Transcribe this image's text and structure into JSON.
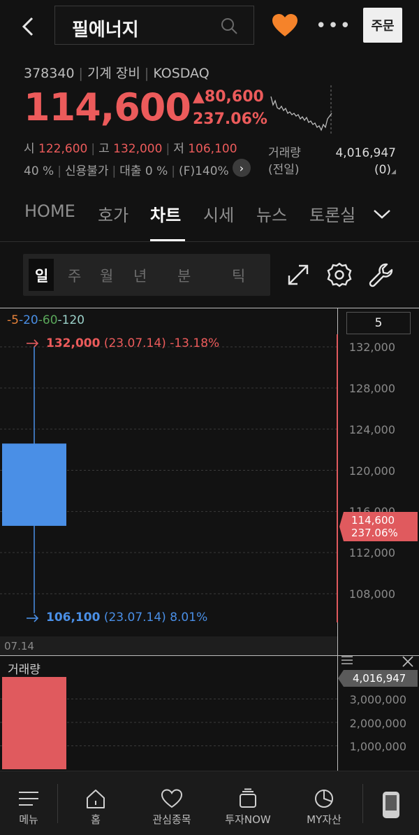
{
  "header": {
    "stock_name": "필에너지",
    "order_label": "주문",
    "more_label": "•••"
  },
  "stock": {
    "code": "378340",
    "sector": "기계 장비",
    "market": "KOSDAQ",
    "price": "114,600",
    "change": "▲80,600",
    "change_pct": "237.06%",
    "open_label": "시",
    "open": "122,600",
    "high_label": "고",
    "high": "132,000",
    "low_label": "저",
    "low": "106,100",
    "flags": [
      "40 %",
      "신용불가",
      "대출 0 %",
      "(F)140%"
    ],
    "prev_volume_label_1": "거래량",
    "prev_volume_label_2": "(전일)",
    "prev_volume_value": "4,016,947",
    "prev_volume_sub": "(0)"
  },
  "tabs": [
    "HOME",
    "호가",
    "차트",
    "시세",
    "뉴스",
    "토론실"
  ],
  "active_tab": "차트",
  "periods": [
    "일",
    "주",
    "월",
    "년",
    "분",
    "틱"
  ],
  "active_period": "일",
  "chart": {
    "ma_legend": [
      {
        "label": "5",
        "color": "#e6823a"
      },
      {
        "label": "20",
        "color": "#4a8fe6"
      },
      {
        "label": "60",
        "color": "#5aa85a"
      },
      {
        "label": "120",
        "color": "#9ad0c8"
      }
    ],
    "count_box": "5",
    "high_text": "132,000",
    "high_detail": "(23.07.14) -13.18%",
    "low_text": "106,100",
    "low_detail": "(23.07.14) 8.01%",
    "current_price": "114,600",
    "current_pct": "237.06%",
    "date_label": "07.14",
    "y_ticks": [
      "132,000",
      "128,000",
      "124,000",
      "120,000",
      "116,000",
      "112,000",
      "108,000"
    ],
    "volume_title": "거래량",
    "volume_value": "4,016,947",
    "volume_ticks": [
      "3,000,000",
      "2,000,000",
      "1,000,000"
    ]
  },
  "chart_data": {
    "type": "candlestick",
    "categories": [
      "07.14"
    ],
    "open": [
      122600
    ],
    "high": [
      132000
    ],
    "low": [
      106100
    ],
    "close": [
      114600
    ],
    "volume": [
      4016947
    ],
    "ylim": [
      105000,
      133000
    ],
    "volume_ylim": [
      0,
      4016947
    ],
    "colors": {
      "down": "#4a8fe6",
      "up": "#e05a5e"
    }
  },
  "bottom_nav": [
    "메뉴",
    "홈",
    "관심종목",
    "투자NOW",
    "MY자산"
  ],
  "colors": {
    "up": "#ec5b5b",
    "down": "#4a8fe6",
    "heart": "#f5832a",
    "background": "#121212"
  }
}
